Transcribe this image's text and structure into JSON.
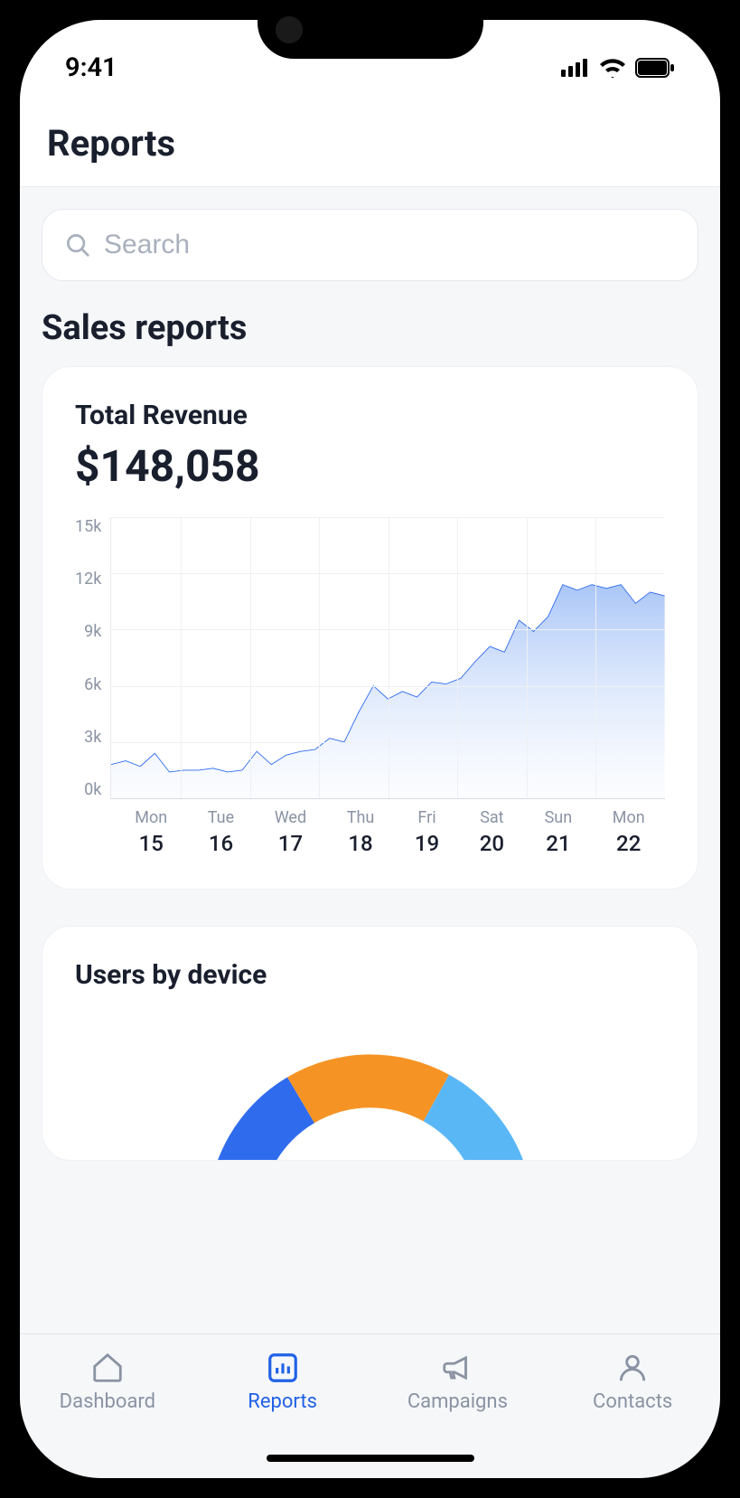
{
  "status_bar": {
    "time": "9:41"
  },
  "header": {
    "title": "Reports"
  },
  "search": {
    "placeholder": "Search",
    "value": ""
  },
  "section": {
    "title": "Sales reports"
  },
  "revenue_card": {
    "title": "Total Revenue",
    "value": "$148,058"
  },
  "devices_card": {
    "title": "Users by device"
  },
  "chart_data": [
    {
      "type": "area",
      "title": "Total Revenue",
      "xlabel": "",
      "ylabel": "",
      "ylim": [
        0,
        15000
      ],
      "y_ticks": [
        "15k",
        "12k",
        "9k",
        "6k",
        "3k",
        "0k"
      ],
      "x_categories": [
        {
          "dow": "Mon",
          "day": "15"
        },
        {
          "dow": "Tue",
          "day": "16"
        },
        {
          "dow": "Wed",
          "day": "17"
        },
        {
          "dow": "Thu",
          "day": "18"
        },
        {
          "dow": "Fri",
          "day": "19"
        },
        {
          "dow": "Sat",
          "day": "20"
        },
        {
          "dow": "Sun",
          "day": "21"
        },
        {
          "dow": "Mon",
          "day": "22"
        }
      ],
      "values": [
        1800,
        2000,
        1700,
        2400,
        1400,
        1500,
        1500,
        1600,
        1400,
        1500,
        2500,
        1800,
        2300,
        2500,
        2600,
        3200,
        3000,
        4600,
        6000,
        5300,
        5700,
        5400,
        6200,
        6100,
        6400,
        7300,
        8100,
        7800,
        9500,
        8900,
        9700,
        11400,
        11100,
        11400,
        11200,
        11400,
        10400,
        11000,
        10800
      ],
      "line_color": "#2f6bed",
      "fill_top_color": "#9bbcf6",
      "fill_bottom_color": "#eaf1fd"
    },
    {
      "type": "pie",
      "title": "Users by device",
      "series": [
        {
          "name": "segment-1",
          "value": 33,
          "color": "#2f6bed"
        },
        {
          "name": "segment-2",
          "value": 33,
          "color": "#f59425"
        },
        {
          "name": "segment-3",
          "value": 34,
          "color": "#5ab7f5"
        }
      ]
    }
  ],
  "tabs": {
    "items": [
      {
        "label": "Dashboard",
        "active": false
      },
      {
        "label": "Reports",
        "active": true
      },
      {
        "label": "Campaigns",
        "active": false
      },
      {
        "label": "Contacts",
        "active": false
      }
    ]
  }
}
